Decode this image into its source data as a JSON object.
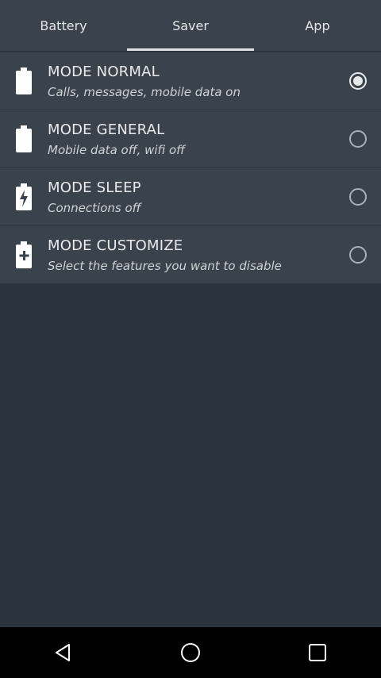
{
  "tabs": [
    {
      "label": "Battery"
    },
    {
      "label": "Saver"
    },
    {
      "label": "App"
    }
  ],
  "active_tab": "Saver",
  "modes": [
    {
      "title": "MODE NORMAL",
      "subtitle": "Calls, messages, mobile data on",
      "selected": true,
      "icon": "battery-icon"
    },
    {
      "title": "MODE GENERAL",
      "subtitle": "Mobile data off, wifi off",
      "selected": false,
      "icon": "battery-icon"
    },
    {
      "title": "MODE SLEEP",
      "subtitle": "Connections off",
      "selected": false,
      "icon": "battery-charging-icon"
    },
    {
      "title": "MODE CUSTOMIZE",
      "subtitle": "Select the features you want to disable",
      "selected": false,
      "icon": "battery-plus-icon"
    }
  ],
  "navbar": [
    "back-icon",
    "home-icon",
    "recent-apps-icon"
  ]
}
